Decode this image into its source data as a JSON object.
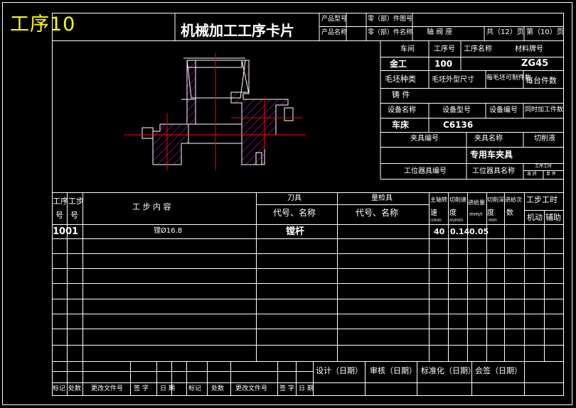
{
  "drawing_title": "工序10",
  "card_title": "机械加工工序卡片",
  "header": {
    "product_model_label": "产品型号",
    "product_name_label": "产品名称",
    "part_drawing_no_label": "零（部）件图号",
    "part_name_label": "零（部）件名称",
    "part_name_value": "轴 阀 座",
    "total_pages": "共（12）页",
    "page_no": "第（10）页"
  },
  "info": {
    "workshop_label": "车间",
    "process_no_label": "工序号",
    "process_name_label": "工序名称",
    "material_label": "材料牌号",
    "workshop_value": "金工",
    "process_no_value": "100",
    "material_value": "ZG45",
    "blank_type_label": "毛坯种类",
    "blank_size_label": "毛坯外型尺寸",
    "pieces_per_blank_label": "每毛坯可制件数",
    "pieces_per_unit_label": "每台件数",
    "blank_type_value": "铸 件",
    "equip_name_label": "设备名称",
    "equip_model_label": "设备型号",
    "equip_no_label": "设备编号",
    "simultaneous_label": "同时加工件数",
    "equip_name_value": "车床",
    "equip_model_value": "C6136",
    "fixture_no_label": "夹具编号",
    "fixture_name_label": "夹具名称",
    "coolant_label": "切削液",
    "fixture_name_value": "专用车夹具",
    "station_tool_no_label": "工位器具编号",
    "station_tool_name_label": "工位器具名称",
    "time_label": "工序工时",
    "time_quasi": "准 终",
    "time_unit": "单 件"
  },
  "table": {
    "col_step_a": "工序",
    "col_step_b": "工步",
    "col_step_a2": "号",
    "col_step_b2": "号",
    "col_content": "工 步 内 容",
    "col_tool": "刀具",
    "col_tool_sub": "代号、名称",
    "col_gauge": "量检具",
    "col_gauge_sub": "代号、名称",
    "col_speed": "主轴转",
    "col_speed2": "速",
    "col_speed_unit": "r/min",
    "col_cut_speed": "切削速",
    "col_cut_speed2": "度",
    "col_cut_speed_unit": "m/min",
    "col_feed": "进给量",
    "col_feed_unit": "mm/r",
    "col_depth": "切削深",
    "col_depth2": "度",
    "col_depth_unit": "mm",
    "col_passes": "进给次",
    "col_passes2": "数",
    "col_hours": "工步工时",
    "col_motor": "机动",
    "col_aux": "辅助",
    "rows": [
      {
        "proc": "100",
        "step": "1",
        "content": "镗Ø16.8",
        "tool": "镗杆",
        "speed": "40",
        "cut_speed": "0.14",
        "feed": "0.05"
      }
    ]
  },
  "footer": {
    "design": "设计（日期）",
    "review": "审核（日期）",
    "standard": "标准化（日期）",
    "countersign": "会签（日期）",
    "rev_cols": [
      "标记",
      "处数",
      "更改文件号",
      "签 字",
      "日 期",
      "标记",
      "处数",
      "更改文件号",
      "签 字",
      "日 期"
    ]
  },
  "colors": {
    "frame": "#ffffff",
    "title_yellow": "#ffff00",
    "center_line": "#ff0000",
    "hatch": "#ff00ff",
    "outline": "#ffffff"
  }
}
